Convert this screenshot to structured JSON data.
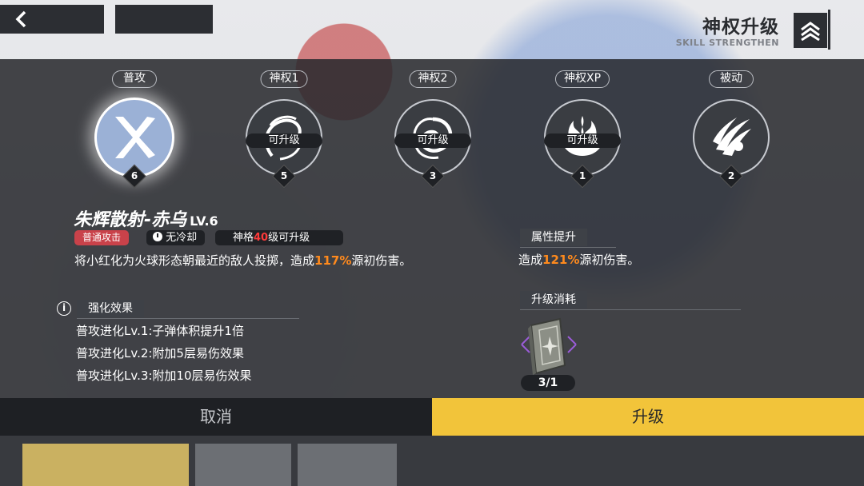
{
  "header": {
    "title": "神权升级",
    "subtitle": "SKILL STRENGTHEN"
  },
  "skills": [
    {
      "tab": "普攻",
      "level": "6",
      "upgrade_tag": "",
      "active": true,
      "icon": "cross-blades-icon"
    },
    {
      "tab": "神权1",
      "level": "5",
      "upgrade_tag": "可升级",
      "active": false,
      "icon": "flame-swirl-icon"
    },
    {
      "tab": "神权2",
      "level": "3",
      "upgrade_tag": "可升级",
      "active": false,
      "icon": "vortex-icon"
    },
    {
      "tab": "神权XP",
      "level": "1",
      "upgrade_tag": "可升级",
      "active": false,
      "icon": "phoenix-flame-icon"
    },
    {
      "tab": "被动",
      "level": "2",
      "upgrade_tag": "",
      "active": false,
      "icon": "claw-slash-icon"
    }
  ],
  "detail": {
    "name": "朱辉散射-赤乌",
    "level_text": "LV.6",
    "type_badge": "普通攻击",
    "cooldown_badge": "无冷却",
    "requirement_prefix": "神格",
    "requirement_value": "40",
    "requirement_suffix": "级可升级",
    "description_prefix": "将小红化为火球形态朝最近的敌人投掷，造成",
    "description_value": "117%",
    "description_suffix": "源初伤害。",
    "enhance_label": "强化效果",
    "evolutions": [
      "普攻进化Lv.1:子弹体积提升1倍",
      "普攻进化Lv.2:附加5层易伤效果",
      "普攻进化Lv.3:附加10层易伤效果"
    ]
  },
  "attribute": {
    "label": "属性提升",
    "prefix": "造成",
    "value": "121%",
    "suffix": "源初伤害。"
  },
  "cost": {
    "label": "升级消耗",
    "item_icon": "skill-book-icon",
    "count": "3/1"
  },
  "buttons": {
    "cancel": "取消",
    "upgrade": "升级"
  },
  "colors": {
    "accent": "#f2c43a",
    "highlight_orange": "#ff8a1d",
    "highlight_red": "#ff3a3a",
    "type_badge": "#c9424a"
  }
}
